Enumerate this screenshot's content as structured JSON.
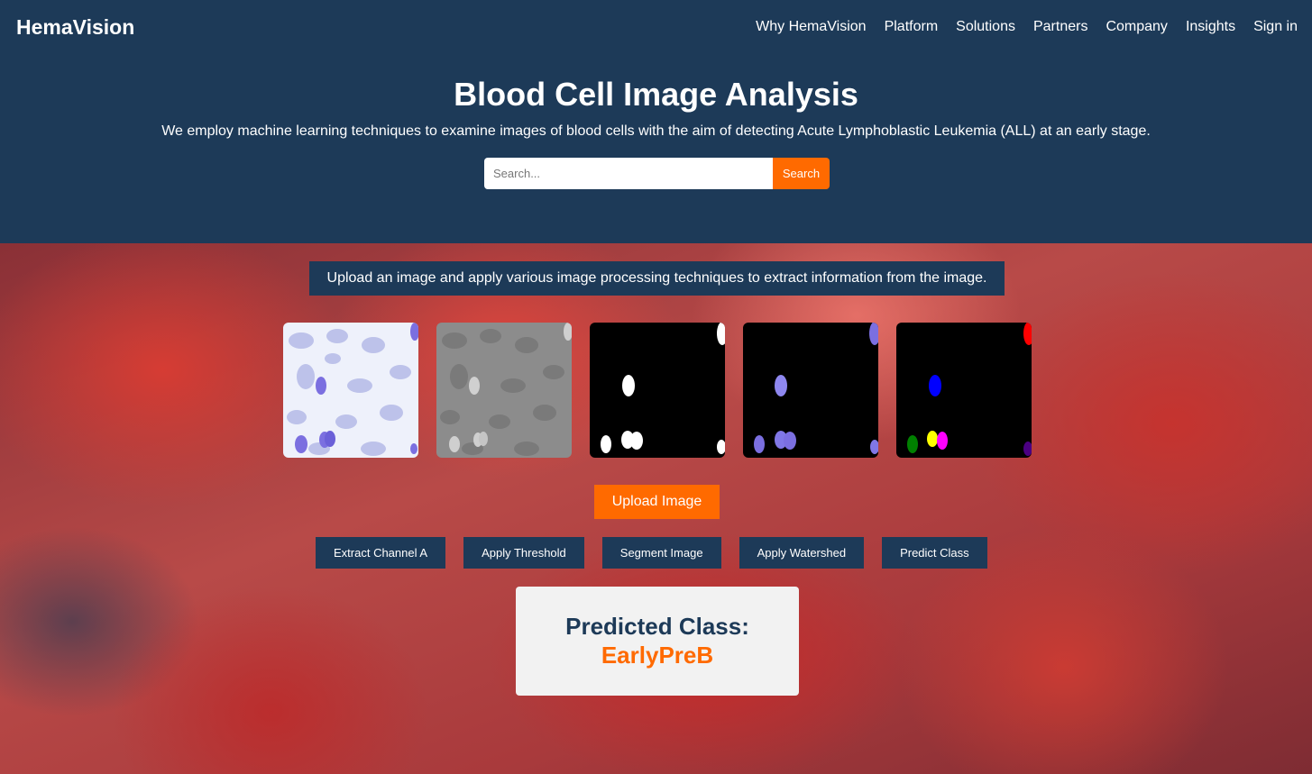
{
  "brand": "HemaVision",
  "nav": [
    "Why HemaVision",
    "Platform",
    "Solutions",
    "Partners",
    "Company",
    "Insights",
    "Sign in"
  ],
  "hero": {
    "title": "Blood Cell Image Analysis",
    "subtitle": "We employ machine learning techniques to examine images of blood cells with the aim of detecting Acute Lymphoblastic Leukemia (ALL) at an early stage."
  },
  "search": {
    "placeholder": "Search...",
    "button": "Search"
  },
  "banner": "Upload an image and apply various image processing techniques to extract information from the image.",
  "upload_button": "Upload Image",
  "actions": [
    "Extract Channel A",
    "Apply Threshold",
    "Segment Image",
    "Apply Watershed",
    "Predict Class"
  ],
  "result": {
    "label": "Predicted Class:",
    "value": "EarlyPreB"
  },
  "colors": {
    "navy": "#1d3a58",
    "orange": "#ff6a00",
    "result_bg": "#f2f2f2"
  }
}
